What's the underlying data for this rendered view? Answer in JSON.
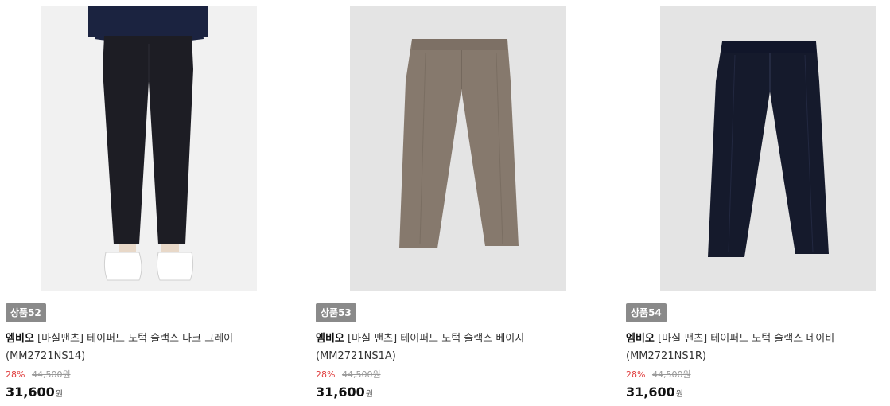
{
  "products": [
    {
      "badge": "상품52",
      "brand": "엠비오",
      "name": "[마실팬츠] 테이퍼드 노턱 슬랙스 다크 그레이",
      "code": "(MM2721NS14)",
      "discount": "28%",
      "original_price": "44,500원",
      "price": "31,600",
      "currency": "원",
      "image_bg": "#f1f1f1",
      "pants_color": "#1d1d24"
    },
    {
      "badge": "상품53",
      "brand": "엠비오",
      "name": "[마실 팬츠] 테이퍼드 노턱 슬랙스 베이지",
      "code": "(MM2721NS1A)",
      "discount": "28%",
      "original_price": "44,500원",
      "price": "31,600",
      "currency": "원",
      "image_bg": "#e4e4e4",
      "pants_color": "#86796d"
    },
    {
      "badge": "상품54",
      "brand": "엠비오",
      "name": "[마실 팬츠] 테이퍼드 노턱 슬랙스 네이비",
      "code": "(MM2721NS1R)",
      "discount": "28%",
      "original_price": "44,500원",
      "price": "31,600",
      "currency": "원",
      "image_bg": "#e4e4e4",
      "pants_color": "#151a2c"
    }
  ]
}
